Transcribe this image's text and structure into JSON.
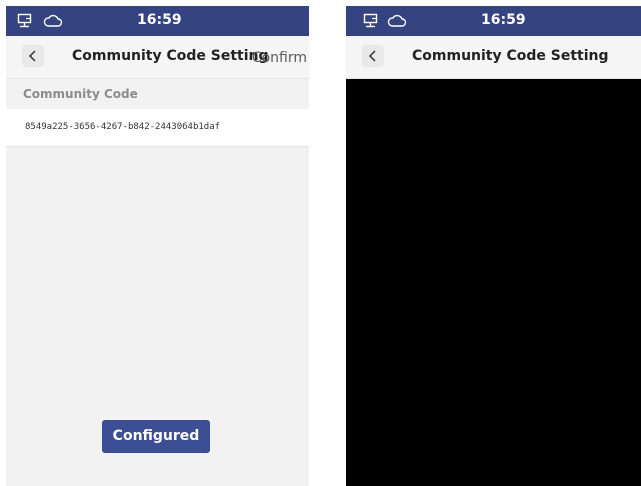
{
  "left_screen": {
    "status_bar": {
      "time": "16:59",
      "icons": [
        "network-icon",
        "cloud-icon"
      ]
    },
    "nav": {
      "title": "Community Code Setting",
      "back_icon": "chevron-left-icon",
      "confirm_label": "Confirm"
    },
    "section_label": "Community Code",
    "community_code": "8549a225-3656-4267-b842-2443064b1daf",
    "configured_label": "Configured"
  },
  "right_screen": {
    "status_bar": {
      "time": "16:59",
      "icons": [
        "network-icon",
        "cloud-icon"
      ]
    },
    "nav": {
      "title": "Community Code Setting",
      "back_icon": "chevron-left-icon"
    }
  },
  "colors": {
    "status_bar": "#354481",
    "primary_button": "#3c4f95",
    "content_background": "#f2f2f2",
    "scanner_background": "#000000"
  }
}
